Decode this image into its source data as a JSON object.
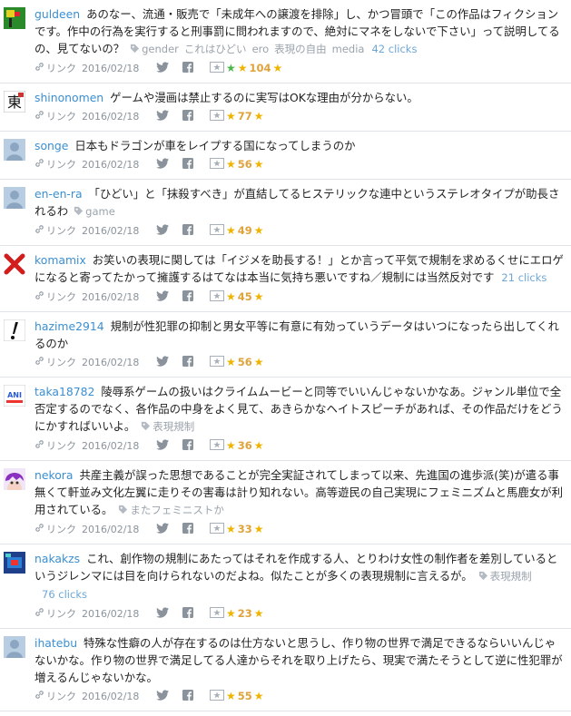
{
  "comments": [
    {
      "user": "guldeen",
      "text": "あのなー、流通・販売で「未成年への譲渡を排除」し、かつ冒頭で「この作品はフィクションです。作中の行為を実行すると刑事罰に問われますので、絶対にマネをしないで下さい」って説明してるの、見てないの？",
      "tags": [
        "gender",
        "これはひどい",
        "ero",
        "表現の自由",
        "media"
      ],
      "clicks": "42 clicks",
      "link_label": "リンク",
      "date": "2016/02/18",
      "green_stars": "★",
      "stars": "104",
      "avatar": "flag-icon"
    },
    {
      "user": "shinonomen",
      "text": "ゲームや漫画は禁止するのに実写はOKな理由が分からない。",
      "tags": [],
      "clicks": "",
      "link_label": "リンク",
      "date": "2016/02/18",
      "green_stars": "",
      "stars": "77",
      "avatar": "kanji-icon"
    },
    {
      "user": "songe",
      "text": "日本もドラゴンが車をレイプする国になってしまうのか",
      "tags": [],
      "clicks": "",
      "link_label": "リンク",
      "date": "2016/02/18",
      "green_stars": "",
      "stars": "56",
      "avatar": "default-user-icon"
    },
    {
      "user": "en-en-ra",
      "text": "「ひどい」と「抹殺すべき」が直結してるヒステリックな連中というステレオタイプが助長されるわ",
      "tags": [
        "game"
      ],
      "clicks": "",
      "link_label": "リンク",
      "date": "2016/02/18",
      "green_stars": "",
      "stars": "49",
      "avatar": "default-user-icon"
    },
    {
      "user": "komamix",
      "text": "お笑いの表現に関しては「イジメを助長する！」とか言って平気で規制を求めるくせにエロゲになると寄ってたかって擁護するはてなは本当に気持ち悪いですね／規制には当然反対です",
      "tags": [],
      "clicks": "21 clicks",
      "link_label": "リンク",
      "date": "2016/02/18",
      "green_stars": "",
      "stars": "45",
      "avatar": "red-x-icon"
    },
    {
      "user": "hazime2914",
      "text": "規制が性犯罪の抑制と男女平等に有意に有効っていうデータはいつになったら出してくれるのか",
      "tags": [],
      "clicks": "",
      "link_label": "リンク",
      "date": "2016/02/18",
      "green_stars": "",
      "stars": "56",
      "avatar": "exclamation-icon"
    },
    {
      "user": "taka18782",
      "text": "陵辱系ゲームの扱いはクライムムービーと同等でいいんじゃないかなあ。ジャンル単位で全否定するのでなく、各作品の中身をよく見て、あきらかなヘイトスピーチがあれば、その作品だけをどうにかすればいいよ。",
      "tags": [
        "表現規制"
      ],
      "clicks": "",
      "link_label": "リンク",
      "date": "2016/02/18",
      "green_stars": "",
      "stars": "36",
      "avatar": "logo-icon"
    },
    {
      "user": "nekora",
      "text": "共産主義が誤った思想であることが完全実証されてしまって以来、先進国の進歩派(笑)が遣る事無くて軒並み文化左翼に走りその害毒は計り知れない。高等遊民の自己実現にフェミニズムと馬鹿女が利用されている。",
      "tags": [
        "またフェミニストか"
      ],
      "clicks": "",
      "link_label": "リンク",
      "date": "2016/02/18",
      "green_stars": "",
      "stars": "33",
      "avatar": "anime-icon"
    },
    {
      "user": "nakakzs",
      "text": "これ、創作物の規制にあたってはそれを作成する人、とりわけ女性の制作者を差別しているというジレンマには目を向けられないのだよね。似たことが多くの表現規制に言えるが。",
      "tags": [
        "表現規制"
      ],
      "clicks": "76 clicks",
      "link_label": "リンク",
      "date": "2016/02/18",
      "green_stars": "",
      "stars": "23",
      "avatar": "pixel-icon"
    },
    {
      "user": "ihatebu",
      "text": "特殊な性癖の人が存在するのは仕方ないと思うし、作り物の世界で満足できるならいいんじゃないかな。作り物の世界で満足してる人達からそれを取り上げたら、現実で満たそうとして逆に性犯罪が増えるんじゃないかな。",
      "tags": [],
      "clicks": "",
      "link_label": "リンク",
      "date": "2016/02/18",
      "green_stars": "",
      "stars": "55",
      "avatar": "default-user-icon"
    }
  ]
}
